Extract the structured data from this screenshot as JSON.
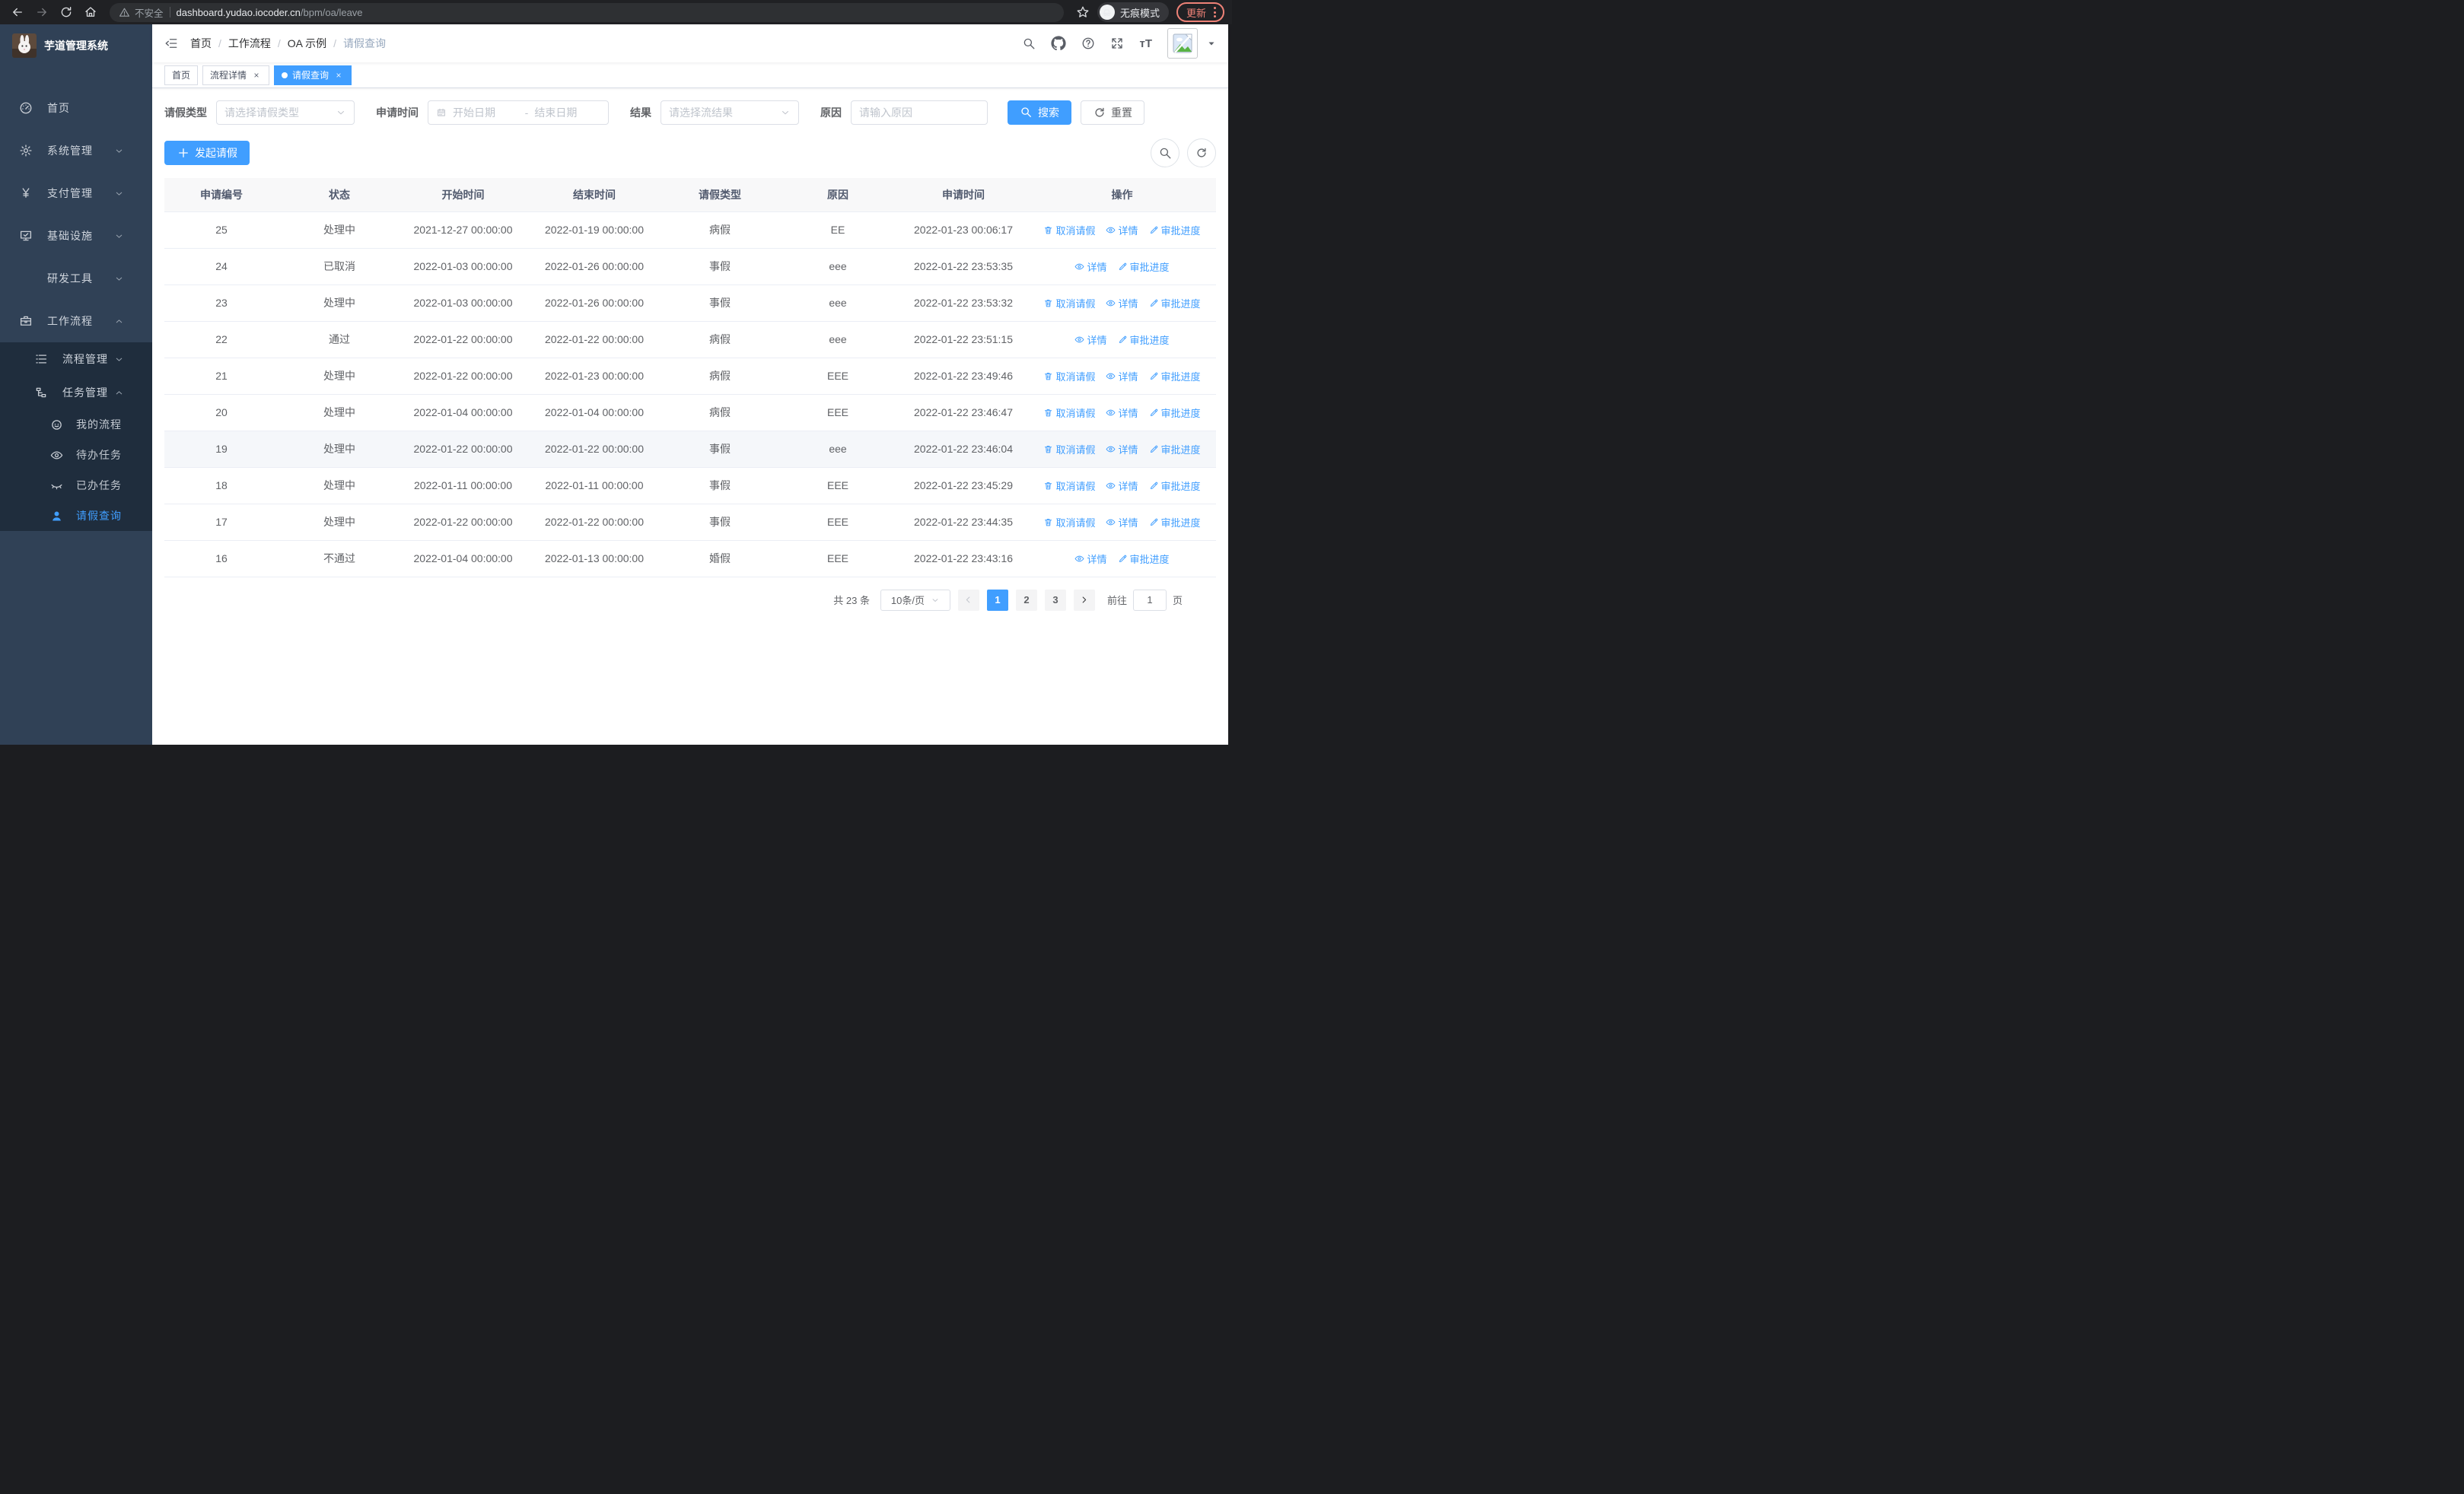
{
  "colors": {
    "accent": "#409eff",
    "sidebar_bg": "#304156",
    "submenu_bg": "#1f2d3d",
    "update_red": "#ee8277"
  },
  "browser": {
    "security_label": "不安全",
    "url_host": "dashboard.yudao.iocoder.cn",
    "url_path": "/bpm/oa/leave",
    "incognito_label": "无痕模式",
    "update_label": "更新"
  },
  "sidebar": {
    "logo_title": "芋道管理系统",
    "items": [
      {
        "label": "首页",
        "icon": "dashboard-icon",
        "arrow": "",
        "active": false
      },
      {
        "label": "系统管理",
        "icon": "gear-icon",
        "arrow": "down",
        "active": false
      },
      {
        "label": "支付管理",
        "icon": "yen-icon",
        "arrow": "down",
        "active": false
      },
      {
        "label": "基础设施",
        "icon": "monitor-icon",
        "arrow": "down",
        "active": false
      },
      {
        "label": "研发工具",
        "icon": "toolbox-icon",
        "arrow": "down",
        "active": false
      },
      {
        "label": "工作流程",
        "icon": "briefcase-icon",
        "arrow": "up",
        "active": false
      }
    ],
    "workflow_children": [
      {
        "label": "流程管理",
        "icon": "list-icon",
        "arrow": "down",
        "level": 1,
        "active": false
      },
      {
        "label": "任务管理",
        "icon": "tree-icon",
        "arrow": "up",
        "level": 1,
        "active": false
      },
      {
        "label": "我的流程",
        "icon": "robot-icon",
        "arrow": "",
        "level": 2,
        "active": false
      },
      {
        "label": "待办任务",
        "icon": "eye-icon",
        "arrow": "",
        "level": 2,
        "active": false
      },
      {
        "label": "已办任务",
        "icon": "eye-closed-icon",
        "arrow": "",
        "level": 2,
        "active": false
      },
      {
        "label": "请假查询",
        "icon": "user-icon",
        "arrow": "",
        "level": 2,
        "active": true
      }
    ]
  },
  "header": {
    "breadcrumb": [
      {
        "label": "首页",
        "current": false
      },
      {
        "label": "工作流程",
        "current": false
      },
      {
        "label": "OA 示例",
        "current": false
      },
      {
        "label": "请假查询",
        "current": true
      }
    ],
    "separator": "/"
  },
  "tags": [
    {
      "label": "首页",
      "active": false,
      "closable": false
    },
    {
      "label": "流程详情",
      "active": false,
      "closable": true
    },
    {
      "label": "请假查询",
      "active": true,
      "closable": true
    }
  ],
  "filters": {
    "leave_type_label": "请假类型",
    "leave_type_placeholder": "请选择请假类型",
    "apply_time_label": "申请时间",
    "start_date_placeholder": "开始日期",
    "range_separator": "-",
    "end_date_placeholder": "结束日期",
    "result_label": "结果",
    "result_placeholder": "请选择流结果",
    "reason_label": "原因",
    "reason_placeholder": "请输入原因",
    "search_label": "搜索",
    "reset_label": "重置"
  },
  "toolbar": {
    "create_label": "发起请假"
  },
  "table": {
    "headers": [
      "申请编号",
      "状态",
      "开始时间",
      "结束时间",
      "请假类型",
      "原因",
      "申请时间",
      "操作"
    ],
    "action_labels": {
      "cancel": "取消请假",
      "detail": "详情",
      "progress": "审批进度"
    },
    "rows": [
      {
        "id": "25",
        "status": "处理中",
        "start": "2021-12-27 00:00:00",
        "end": "2022-01-19 00:00:00",
        "type": "病假",
        "reason": "EE",
        "apply_time": "2022-01-23 00:06:17",
        "cancelable": true,
        "highlighted": false
      },
      {
        "id": "24",
        "status": "已取消",
        "start": "2022-01-03 00:00:00",
        "end": "2022-01-26 00:00:00",
        "type": "事假",
        "reason": "eee",
        "apply_time": "2022-01-22 23:53:35",
        "cancelable": false,
        "highlighted": false
      },
      {
        "id": "23",
        "status": "处理中",
        "start": "2022-01-03 00:00:00",
        "end": "2022-01-26 00:00:00",
        "type": "事假",
        "reason": "eee",
        "apply_time": "2022-01-22 23:53:32",
        "cancelable": true,
        "highlighted": false
      },
      {
        "id": "22",
        "status": "通过",
        "start": "2022-01-22 00:00:00",
        "end": "2022-01-22 00:00:00",
        "type": "病假",
        "reason": "eee",
        "apply_time": "2022-01-22 23:51:15",
        "cancelable": false,
        "highlighted": false
      },
      {
        "id": "21",
        "status": "处理中",
        "start": "2022-01-22 00:00:00",
        "end": "2022-01-23 00:00:00",
        "type": "病假",
        "reason": "EEE",
        "apply_time": "2022-01-22 23:49:46",
        "cancelable": true,
        "highlighted": false
      },
      {
        "id": "20",
        "status": "处理中",
        "start": "2022-01-04 00:00:00",
        "end": "2022-01-04 00:00:00",
        "type": "病假",
        "reason": "EEE",
        "apply_time": "2022-01-22 23:46:47",
        "cancelable": true,
        "highlighted": false
      },
      {
        "id": "19",
        "status": "处理中",
        "start": "2022-01-22 00:00:00",
        "end": "2022-01-22 00:00:00",
        "type": "事假",
        "reason": "eee",
        "apply_time": "2022-01-22 23:46:04",
        "cancelable": true,
        "highlighted": true
      },
      {
        "id": "18",
        "status": "处理中",
        "start": "2022-01-11 00:00:00",
        "end": "2022-01-11 00:00:00",
        "type": "事假",
        "reason": "EEE",
        "apply_time": "2022-01-22 23:45:29",
        "cancelable": true,
        "highlighted": false
      },
      {
        "id": "17",
        "status": "处理中",
        "start": "2022-01-22 00:00:00",
        "end": "2022-01-22 00:00:00",
        "type": "事假",
        "reason": "EEE",
        "apply_time": "2022-01-22 23:44:35",
        "cancelable": true,
        "highlighted": false
      },
      {
        "id": "16",
        "status": "不通过",
        "start": "2022-01-04 00:00:00",
        "end": "2022-01-13 00:00:00",
        "type": "婚假",
        "reason": "EEE",
        "apply_time": "2022-01-22 23:43:16",
        "cancelable": false,
        "highlighted": false
      }
    ]
  },
  "pagination": {
    "total": "共 23 条",
    "page_size": "10条/页",
    "pages": [
      "1",
      "2",
      "3"
    ],
    "current": "1",
    "goto_label": "前往",
    "goto_value": "1",
    "page_unit": "页"
  }
}
